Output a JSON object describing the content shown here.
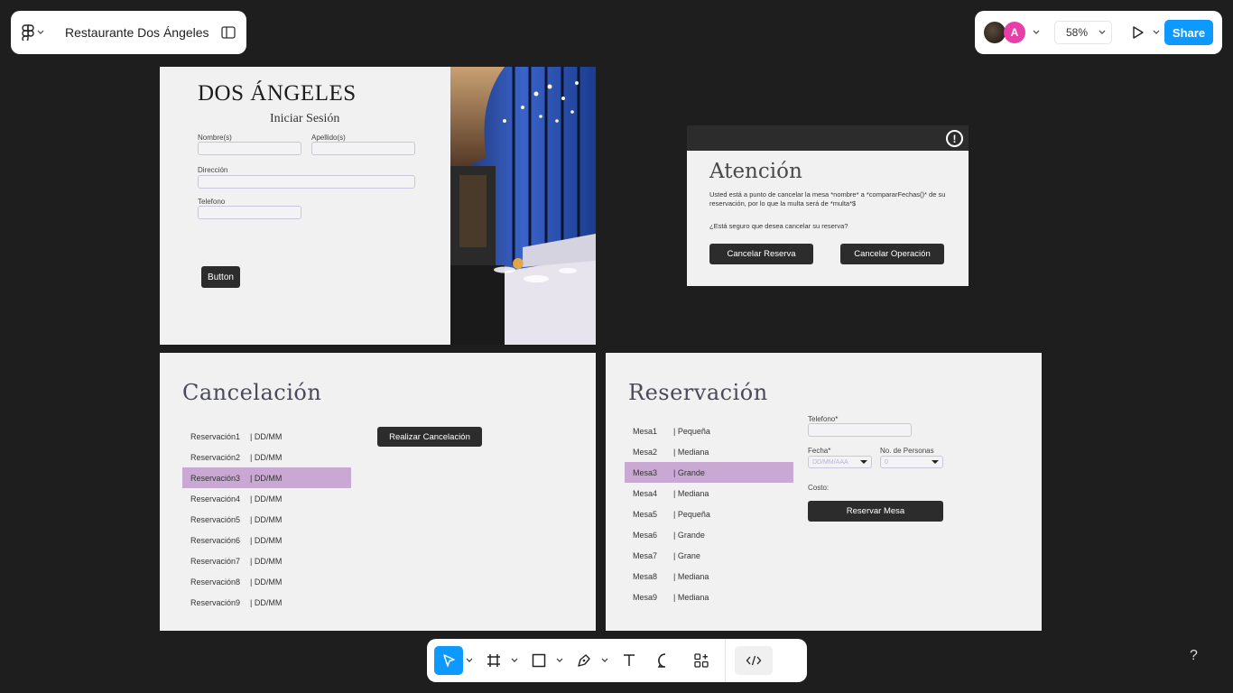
{
  "file": {
    "title": "Restaurante Dos Ángeles"
  },
  "header": {
    "avatar_initial": "A",
    "zoom": "58%",
    "share_label": "Share"
  },
  "login_frame": {
    "brand": "DOS ÁNGELES",
    "subtitle": "Iniciar Sesión",
    "name_label": "Nombre(s)",
    "surname_label": "Apellido(s)",
    "address_label": "Dirección",
    "phone_label": "Telefono",
    "button_label": "Button"
  },
  "dialog": {
    "title": "Atención",
    "message": "Usted está a punto de cancelar  la mesa *nombre* a *compararFechas()* de su reservación, por lo que la multa será de *multa*$",
    "question": "¿Está seguro que desea cancelar su reserva?",
    "confirm_label": "Cancelar Reserva",
    "abort_label": "Cancelar Operación"
  },
  "cancel_frame": {
    "title": "Cancelación",
    "action_label": "Realizar Cancelación",
    "rows": [
      {
        "name": "Reservación1",
        "date": "|  DD/MM"
      },
      {
        "name": "Reservación2",
        "date": "|  DD/MM"
      },
      {
        "name": "Reservación3",
        "date": "|  DD/MM"
      },
      {
        "name": "Reservación4",
        "date": "|  DD/MM"
      },
      {
        "name": "Reservación5",
        "date": "|  DD/MM"
      },
      {
        "name": "Reservación6",
        "date": "|  DD/MM"
      },
      {
        "name": "Reservación7",
        "date": "|  DD/MM"
      },
      {
        "name": "Reservación8",
        "date": "|  DD/MM"
      },
      {
        "name": "Reservación9",
        "date": "|  DD/MM"
      }
    ],
    "selected_index": 2
  },
  "reserve_frame": {
    "title": "Reservación",
    "phone_label": "Telefono*",
    "date_label": "Fecha*",
    "date_placeholder": "DD/MM/AAA",
    "people_label": "No. de Personas",
    "people_value": "0",
    "cost_label": "Costo:",
    "submit_label": "Reservar Mesa",
    "rows": [
      {
        "name": "Mesa1",
        "size": "|  Pequeña"
      },
      {
        "name": "Mesa2",
        "size": "|  Mediana"
      },
      {
        "name": "Mesa3",
        "size": "|  Grande"
      },
      {
        "name": "Mesa4",
        "size": "|  Mediana"
      },
      {
        "name": "Mesa5",
        "size": "|  Pequeña"
      },
      {
        "name": "Mesa6",
        "size": "|  Grande"
      },
      {
        "name": "Mesa7",
        "size": "|  Grane"
      },
      {
        "name": "Mesa8",
        "size": "|  Mediana"
      },
      {
        "name": "Mesa9",
        "size": "|  Mediana"
      }
    ],
    "selected_index": 2
  },
  "help": "?",
  "icons": [
    "figma-menu-icon",
    "sidebar-toggle-icon",
    "chevron-down-icon",
    "play-icon",
    "move-tool-icon",
    "frame-tool-icon",
    "rectangle-tool-icon",
    "pen-tool-icon",
    "text-tool-icon",
    "comment-tool-icon",
    "components-icon",
    "dev-mode-icon",
    "alert-icon"
  ],
  "colors": {
    "accent": "#0d99ff",
    "selection": "#c9a9d4",
    "canvas": "#1e1e1e",
    "frame": "#f1f1f1",
    "button": "#2c2c2c"
  }
}
